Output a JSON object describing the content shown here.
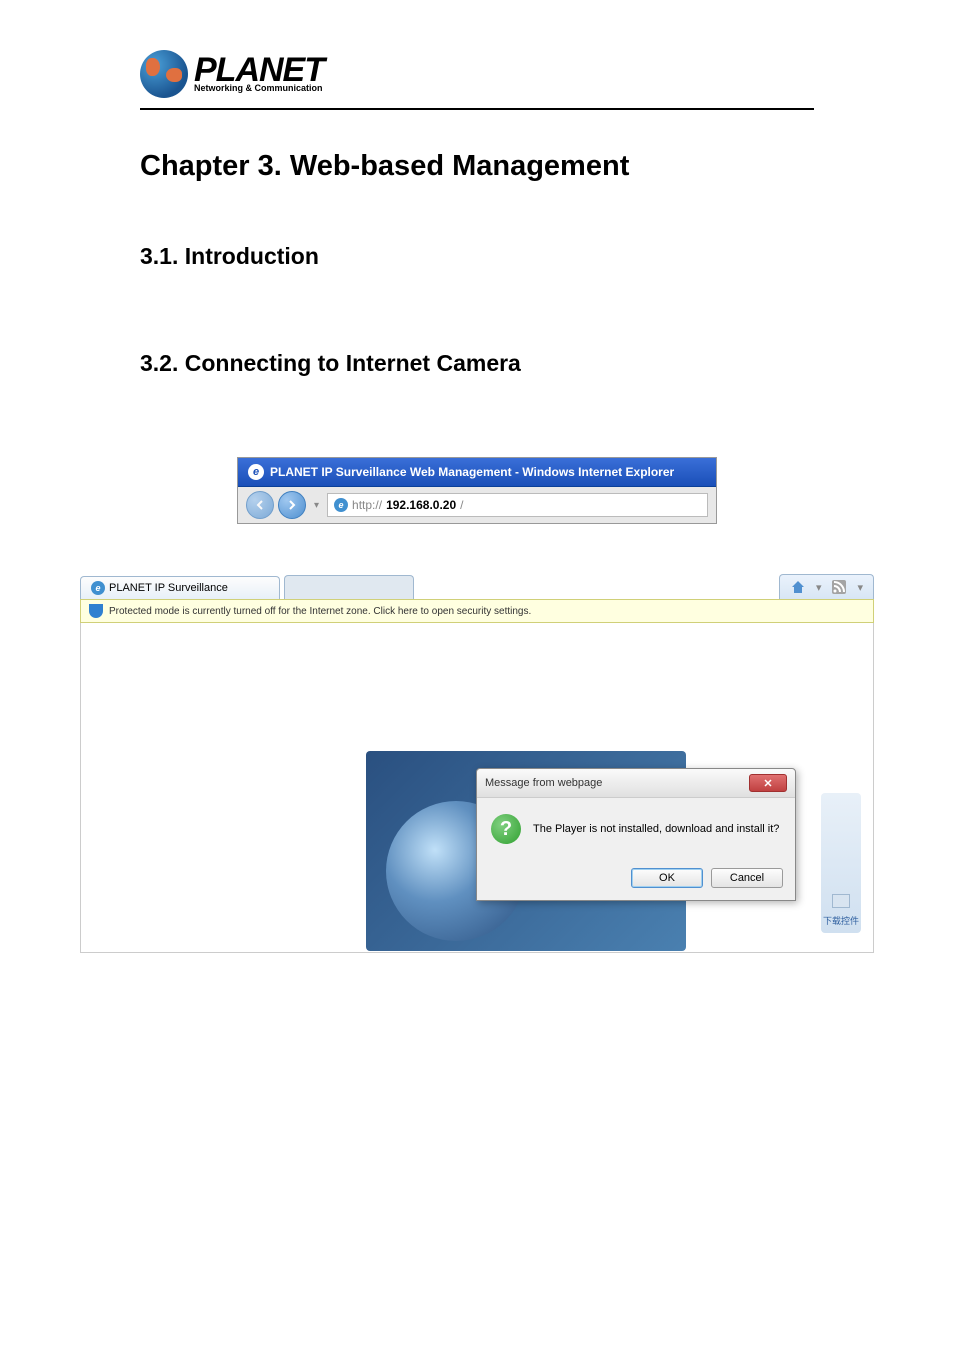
{
  "logo": {
    "brand": "PLANET",
    "tagline": "Networking & Communication"
  },
  "headings": {
    "chapter": "Chapter 3.    Web-based Management",
    "section1": "3.1. Introduction",
    "section2": "3.2. Connecting to Internet Camera"
  },
  "browser1": {
    "title": "PLANET IP Surveillance Web Management - Windows Internet Explorer",
    "url_prefix": "http://",
    "url_bold": "192.168.0.20",
    "url_suffix": "/"
  },
  "browser2": {
    "tab_title": "PLANET IP Surveillance",
    "infobar": "Protected mode is currently turned off for the Internet zone. Click here to open security settings.",
    "download_label": "下载控件"
  },
  "dialog": {
    "title": "Message from webpage",
    "message": "The Player is not installed, download and install it?",
    "ok": "OK",
    "cancel": "Cancel"
  }
}
